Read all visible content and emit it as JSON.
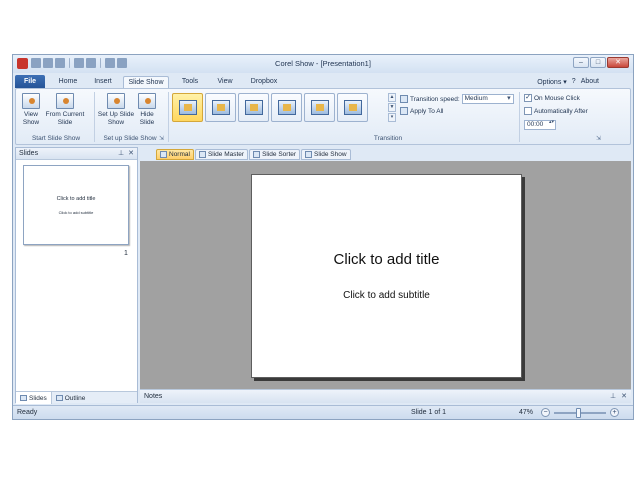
{
  "window": {
    "title": "Corel Show - [Presentation1]"
  },
  "tabs": [
    "File",
    "Home",
    "Insert",
    "Slide Show",
    "Tools",
    "View",
    "Dropbox"
  ],
  "active_tab": "Slide Show",
  "header_links": {
    "options": "Options ▾",
    "about": "About"
  },
  "ribbon": {
    "start_group": {
      "label": "Start Slide Show",
      "view_show": "View Show",
      "from_current": "From Current Slide"
    },
    "setup_group": {
      "label": "Set up Slide Show",
      "set_up": "Set Up Slide Show",
      "hide": "Hide Slide"
    },
    "transition_group": {
      "label": "Transition",
      "speed_label": "Transition speed:",
      "speed_value": "Medium",
      "apply_all": "Apply To All",
      "on_mouse_click": "On Mouse Click",
      "on_mouse_click_checked": true,
      "auto_after": "Automatically After",
      "auto_after_checked": false,
      "time_value": "00:00"
    }
  },
  "slides_pane": {
    "title": "Slides",
    "thumb_title": "Click to add title",
    "thumb_subtitle": "Click to add subtitle",
    "slide_number": "1",
    "tabs": [
      "Slides",
      "Outline"
    ]
  },
  "view_tabs": [
    "Normal",
    "Slide Master",
    "Slide Sorter",
    "Slide Show"
  ],
  "active_view": "Normal",
  "slide": {
    "title": "Click to add title",
    "subtitle": "Click to add subtitle"
  },
  "notes": {
    "label": "Notes"
  },
  "status": {
    "ready": "Ready",
    "slide_info": "Slide 1 of 1",
    "zoom": "47%",
    "zoom_level": 0.47
  },
  "colors": {
    "file_tab": "#2a5ca3",
    "active_transition": "#ffd75e",
    "canvas_bg": "#a1a1a1"
  }
}
